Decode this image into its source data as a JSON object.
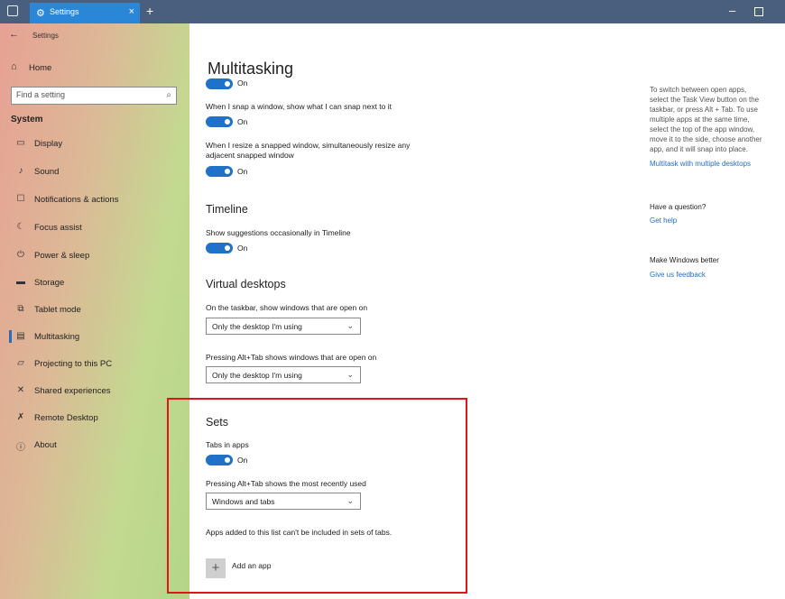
{
  "titlebar": {
    "tab_title": "Settings",
    "tab_close_icon": "×",
    "new_tab_icon": "+",
    "minimize_icon": "–"
  },
  "sidebar": {
    "back_icon": "←",
    "breadcrumb": "Settings",
    "home": {
      "icon": "⌂",
      "label": "Home"
    },
    "search": {
      "placeholder": "Find a setting",
      "icon": "⌕"
    },
    "section": "System",
    "items": [
      {
        "label": "Display",
        "icon": "▭"
      },
      {
        "label": "Sound",
        "icon": "♪"
      },
      {
        "label": "Notifications & actions",
        "icon": "☐"
      },
      {
        "label": "Focus assist",
        "icon": "☾"
      },
      {
        "label": "Power & sleep",
        "icon": "⏻"
      },
      {
        "label": "Storage",
        "icon": "▬"
      },
      {
        "label": "Tablet mode",
        "icon": "⧉"
      },
      {
        "label": "Multitasking",
        "icon": "▤",
        "active": true
      },
      {
        "label": "Projecting to this PC",
        "icon": "▱"
      },
      {
        "label": "Shared experiences",
        "icon": "✕"
      },
      {
        "label": "Remote Desktop",
        "icon": "✗"
      },
      {
        "label": "About",
        "icon": "ⓘ"
      }
    ]
  },
  "main": {
    "title": "Multitasking",
    "snap": {
      "top_toggle_text": "On",
      "setting1_label": "When I snap a window, show what I can snap next to it",
      "setting1_toggle": "On",
      "setting2_label_line1": "When I resize a snapped window, simultaneously resize any",
      "setting2_label_line2": "adjacent snapped window",
      "setting2_toggle": "On"
    },
    "timeline": {
      "heading": "Timeline",
      "label": "Show suggestions occasionally in Timeline",
      "toggle": "On"
    },
    "virtual_desktops": {
      "heading": "Virtual desktops",
      "taskbar_label": "On the taskbar, show windows that are open on",
      "taskbar_value": "Only the desktop I'm using",
      "alttab_label": "Pressing Alt+Tab shows windows that are open on",
      "alttab_value": "Only the desktop I'm using"
    },
    "sets": {
      "heading": "Sets",
      "tabs_label": "Tabs in apps",
      "tabs_toggle": "On",
      "alttab_label": "Pressing Alt+Tab shows the most recently used",
      "alttab_value": "Windows and tabs",
      "exclude_note": "Apps added to this list can't be included in sets of tabs.",
      "add_icon": "+",
      "add_label": "Add an app"
    },
    "chevron_icon": "⌄"
  },
  "aside": {
    "help_lines": [
      "To switch between open apps,",
      "select the Task View button on the",
      "taskbar, or press Alt + Tab. To use",
      "multiple apps at the same time,",
      "select the top of the app window,",
      "move it to the side, choose another",
      "app, and it will snap into place."
    ],
    "multitask_link": "Multitask with multiple desktops",
    "question_head": "Have a question?",
    "get_help_link": "Get help",
    "better_head": "Make Windows better",
    "feedback_link": "Give us feedback"
  },
  "colors": {
    "accent": "#1f72c8",
    "titlebar": "#4a5f7e",
    "active_tab": "#2a87d8",
    "highlight": "#e0141a"
  }
}
